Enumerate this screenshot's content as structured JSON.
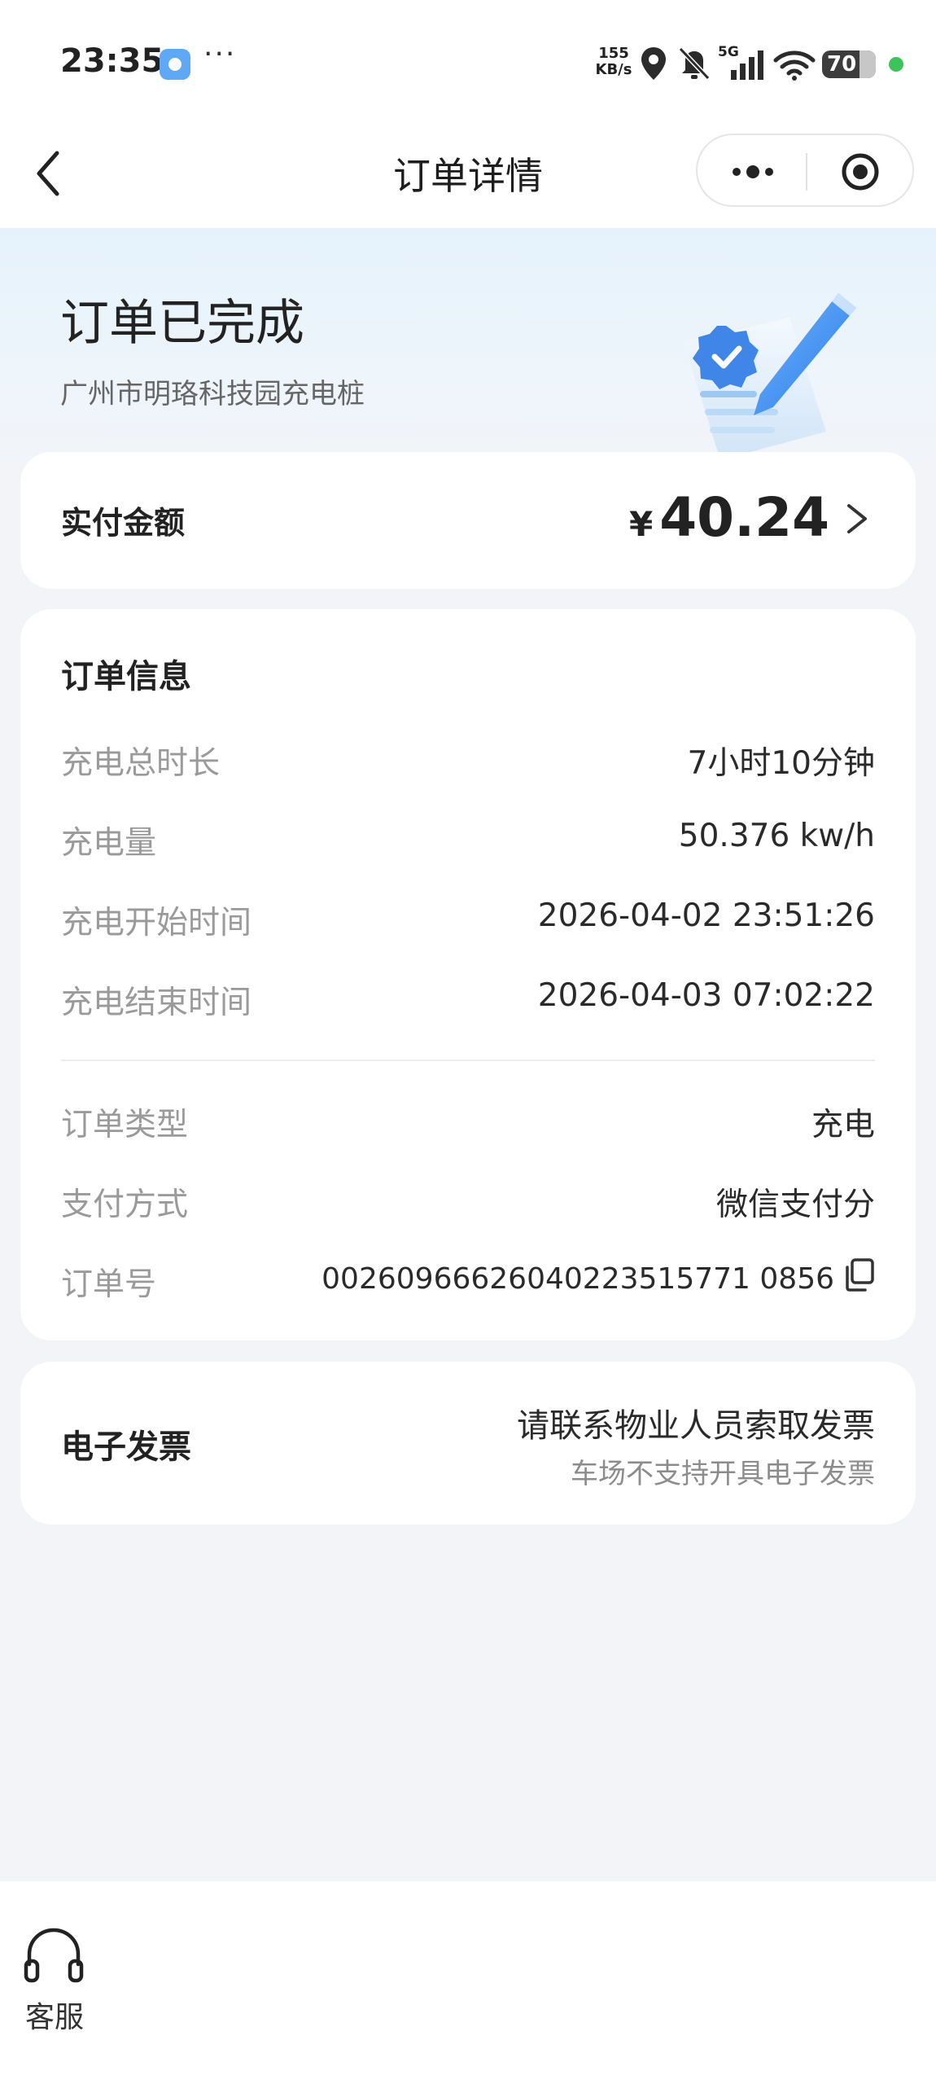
{
  "status_bar": {
    "time": "23:35",
    "more": "···",
    "net_speed_value": "155",
    "net_speed_unit": "KB/s",
    "signal_label": "5G",
    "battery": "70",
    "icons": [
      "app-notification-icon",
      "location-icon",
      "mute-icon",
      "signal-icon",
      "wifi-icon",
      "battery-icon"
    ]
  },
  "nav": {
    "title": "订单详情",
    "back_icon": "chevron-left-icon",
    "more_icon": "more-dots-icon",
    "close_icon": "target-icon"
  },
  "hero": {
    "status": "订单已完成",
    "station": "广州市明珞科技园充电桩"
  },
  "payment": {
    "label": "实付金额",
    "currency": "¥",
    "amount": "40.24"
  },
  "order_info": {
    "title": "订单信息",
    "rows": [
      {
        "key": "充电总时长",
        "value": "7小时10分钟"
      },
      {
        "key": "充电量",
        "value": "50.376 kw/h"
      },
      {
        "key": "充电开始时间",
        "value": "2026-04-02 23:51:26"
      },
      {
        "key": "充电结束时间",
        "value": "2026-04-03 07:02:22"
      },
      {
        "key": "订单类型",
        "value": "充电"
      },
      {
        "key": "支付方式",
        "value": "微信支付分"
      },
      {
        "key": "订单号",
        "value": "00260966626040223515771 0856"
      }
    ]
  },
  "invoice": {
    "label": "电子发票",
    "main": "请联系物业人员索取发票",
    "sub": "车场不支持开具电子发票"
  },
  "bottom": {
    "service_label": "客服"
  }
}
